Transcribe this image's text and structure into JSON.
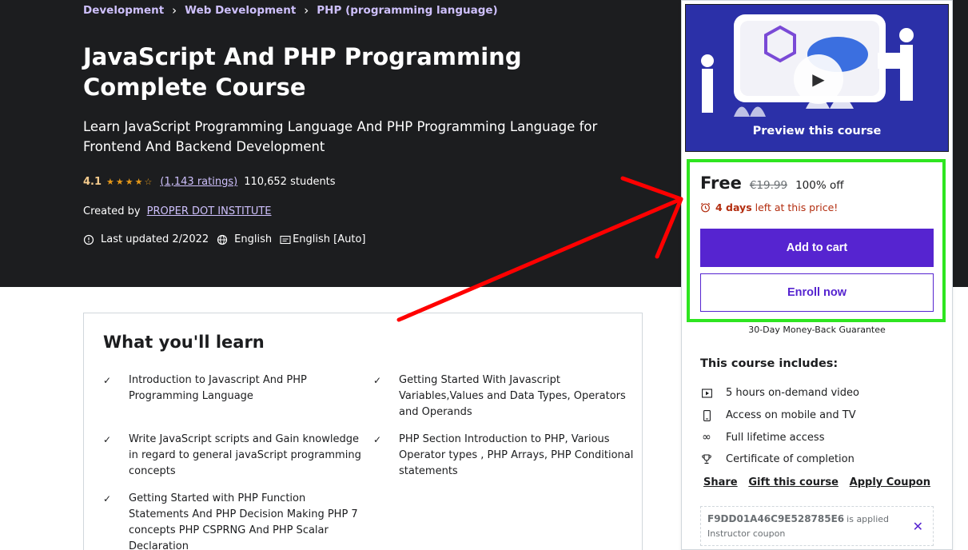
{
  "breadcrumb": {
    "items": [
      "Development",
      "Web Development",
      "PHP (programming language)"
    ]
  },
  "course": {
    "title": "JavaScript And PHP Programming Complete Course",
    "subtitle": "Learn JavaScript Programming Language And PHP Programming Language for Frontend And Backend Development",
    "rating": "4.1",
    "rating_stars": 4.1,
    "ratings_count": "(1,143 ratings)",
    "students": "110,652 students",
    "created_by_label": "Created by",
    "instructor": "PROPER DOT INSTITUTE",
    "last_updated": "Last updated 2/2022",
    "language": "English",
    "captions": "English [Auto]"
  },
  "learn": {
    "title": "What you'll learn",
    "items": [
      "Introduction to Javascript And PHP Programming Language",
      "Getting Started With Javascript Variables,Values and Data Types, Operators and Operands",
      "Write JavaScript scripts and Gain knowledge in regard to general javaScript programming concepts",
      "PHP Section Introduction to PHP, Various Operator types , PHP Arrays, PHP Conditional statements",
      "Getting Started with PHP Function Statements And PHP Decision Making PHP 7 concepts PHP CSPRNG And PHP Scalar Declaration"
    ]
  },
  "sidebar": {
    "preview_label": "Preview this course",
    "price": "Free",
    "original_price": "€19.99",
    "discount": "100% off",
    "timer_bold": "4 days",
    "timer_rest": "left at this price!",
    "add_to_cart": "Add to cart",
    "enroll_now": "Enroll now",
    "guarantee": "30-Day Money-Back Guarantee",
    "includes_title": "This course includes:",
    "includes": [
      {
        "icon": "video-icon",
        "label": "5 hours on-demand video"
      },
      {
        "icon": "mobile-icon",
        "label": "Access on mobile and TV"
      },
      {
        "icon": "infinity-icon",
        "label": "Full lifetime access"
      },
      {
        "icon": "trophy-icon",
        "label": "Certificate of completion"
      }
    ],
    "links": {
      "share": "Share",
      "gift": "Gift this course",
      "coupon": "Apply Coupon"
    },
    "coupon_code": "F9DD01A46C9E528785E6",
    "coupon_applied": "is applied",
    "coupon_sub": "Instructor coupon"
  },
  "colors": {
    "hero_bg": "#1c1d1f",
    "brand_purple": "#5624d0",
    "link_purple": "#cec0fc",
    "star": "#e59819",
    "timer_red": "#b32d0f",
    "annotation_green": "#2ee520",
    "annotation_red": "#ff0000"
  }
}
